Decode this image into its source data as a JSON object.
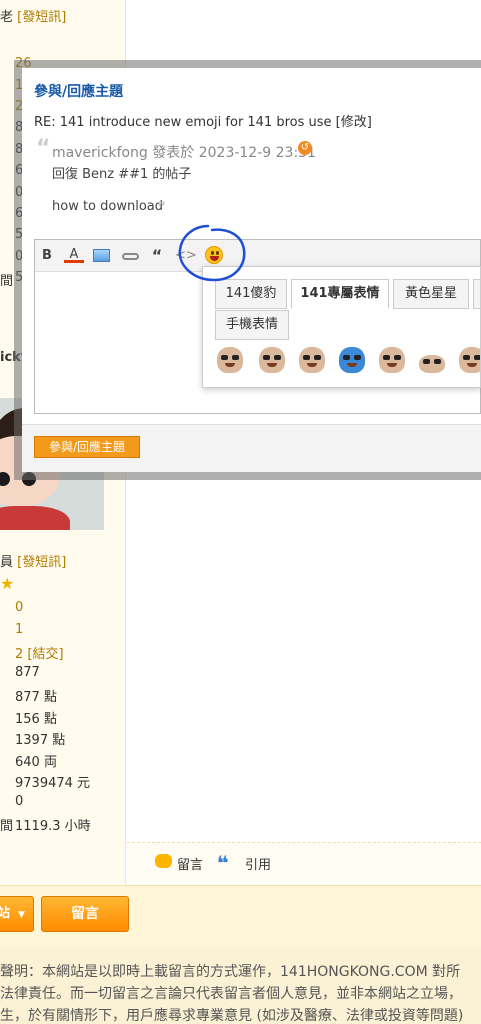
{
  "user_panel": {
    "top_label_prefix": "老",
    "top_link": "[發短訊]",
    "stats_top": [
      "26",
      "1",
      "2",
      "8",
      "8",
      "6",
      "0",
      "6",
      "5",
      "0",
      "5"
    ],
    "hour_label_top": "間",
    "name_fragment": "ickf",
    "rank_prefix": "員",
    "rank_link": "[發短訊]",
    "stats": [
      {
        "value": "0",
        "link": ""
      },
      {
        "value": "1",
        "link": ""
      },
      {
        "value": "2",
        "link": "[結交]"
      },
      {
        "value": "877",
        "link": ""
      },
      {
        "value": "877 點",
        "link": ""
      },
      {
        "value": "156 點",
        "link": ""
      },
      {
        "value": "1397 點",
        "link": ""
      },
      {
        "value": "640 両",
        "link": ""
      },
      {
        "value": "9739474 元",
        "link": ""
      },
      {
        "value": "0",
        "link": ""
      },
      {
        "value": "1119.3 小時",
        "link": ""
      }
    ],
    "hour_label": "間"
  },
  "modal": {
    "title": "參與/回應主題",
    "subject": "RE: 141 introduce new emoji for 141 bros use [修改]",
    "quote_meta": "maverickfong 發表於 2023-12-9 23:31",
    "quote_line1": "回復 Benz ##1 的帖子",
    "quote_line2": "how to download",
    "submit_label": "參與/回應主題"
  },
  "toolbar": {
    "bold": "B",
    "font_color": "A",
    "quote": "“",
    "code": "<>"
  },
  "emoji_tabs": [
    {
      "label": "141傻豹",
      "active": false
    },
    {
      "label": "141專屬表情",
      "active": true
    },
    {
      "label": "黃色星星",
      "active": false
    },
    {
      "label": "手機表情",
      "active": false
    }
  ],
  "reply_bar": {
    "comment_label": "留言",
    "quote_label": "引用"
  },
  "bottom_bar": {
    "left_btn_label": "站",
    "comment_btn_label": "留言"
  },
  "disclaimer": [
    "聲明：本網站是以即時上載留言的方式運作，141HONGKONG.COM 對所",
    "法律責任。而一切留言之言論只代表留言者個人意見，並非本網站之立場，",
    "生，於有關情形下，用戶應尋求專業意見 (如涉及醫療、法律或投資等問題)"
  ],
  "colors": {
    "accent_orange": "#ff9900",
    "link_gold": "#b07a00",
    "title_blue": "#1a5aa8",
    "annotation_blue": "#1f4fd6"
  }
}
